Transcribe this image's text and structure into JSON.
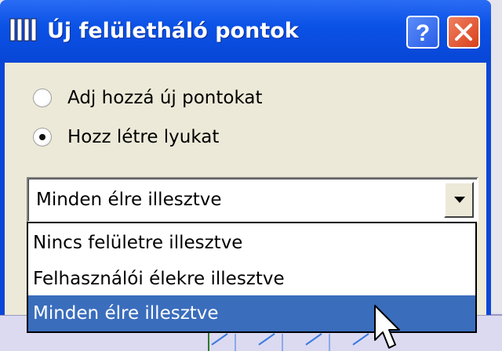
{
  "window": {
    "title": "Új felületháló pontok",
    "help_label": "?",
    "titlebar_color": "#0b52e6"
  },
  "options": [
    {
      "label": "Adj hozzá új pontokat",
      "checked": false
    },
    {
      "label": "Hozz létre lyukat",
      "checked": true
    }
  ],
  "combo": {
    "value": "Minden élre illesztve"
  },
  "dropdown": {
    "items": [
      {
        "label": "Nincs felületre illesztve",
        "selected": false
      },
      {
        "label": "Felhasználói élekre illesztve",
        "selected": false
      },
      {
        "label": "Minden élre illesztve",
        "selected": true
      }
    ],
    "selected_color": "#3a6dbc"
  },
  "icons": {
    "app": "grid-app-icon",
    "help": "help-icon",
    "close": "close-x-icon",
    "dropdown": "chevron-down-icon",
    "cursor": "mouse-pointer-icon"
  }
}
